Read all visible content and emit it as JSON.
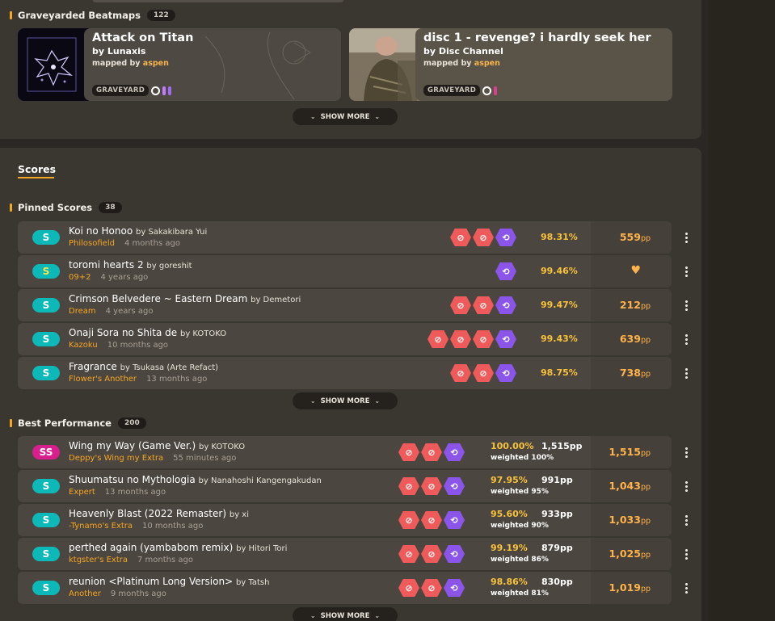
{
  "graveyarded": {
    "label": "Graveyarded Beatmaps",
    "count": "122",
    "show_more": "SHOW MORE",
    "cards": [
      {
        "title": "Attack on Titan",
        "artist": "by Lunaxis",
        "mapped_prefix": "mapped by",
        "mapper": "aspen",
        "status": "GRAVEYARD",
        "pips": [
          "#c37bff",
          "#a06cf0"
        ]
      },
      {
        "title": "disc 1 - revenge? i hardly seek her",
        "artist": "by Disc Channel",
        "mapped_prefix": "mapped by",
        "mapper": "aspen",
        "status": "GRAVEYARD",
        "pips": [
          "#d9418e"
        ]
      }
    ]
  },
  "scores_tab": "Scores",
  "pinned": {
    "label": "Pinned Scores",
    "count": "38",
    "show_more": "SHOW MORE",
    "rows": [
      {
        "rank": "S",
        "rank_class": "rank-s",
        "title": "Koi no Honoo",
        "artist": "by Sakakibara Yui",
        "diff": "Philosofield",
        "ago": "4 months ago",
        "mods": [
          "red",
          "red",
          "purple"
        ],
        "acc": "98.31%",
        "pp": "559",
        "pp_unit": "pp"
      },
      {
        "rank": "S",
        "rank_class": "rank-s2",
        "title": "toromi hearts 2",
        "artist": "by goreshit",
        "diff": "09+2",
        "ago": "4 years ago",
        "mods": [
          "purple"
        ],
        "acc": "99.46%",
        "pp": "",
        "pp_unit": "",
        "heart": true
      },
      {
        "rank": "S",
        "rank_class": "rank-s",
        "title": "Crimson Belvedere ~ Eastern Dream",
        "artist": "by Demetori",
        "diff": "Dream",
        "ago": "4 years ago",
        "mods": [
          "red",
          "red",
          "purple"
        ],
        "acc": "99.47%",
        "pp": "212",
        "pp_unit": "pp"
      },
      {
        "rank": "S",
        "rank_class": "rank-s",
        "title": "Onaji Sora no Shita de",
        "artist": "by KOTOKO",
        "diff": "Kazoku",
        "ago": "10 months ago",
        "mods": [
          "red",
          "red",
          "red",
          "purple"
        ],
        "acc": "99.43%",
        "pp": "639",
        "pp_unit": "pp"
      },
      {
        "rank": "S",
        "rank_class": "rank-s",
        "title": "Fragrance",
        "artist": "by Tsukasa (Arte Refact)",
        "diff": "Flower's Another",
        "ago": "13 months ago",
        "mods": [
          "red",
          "red",
          "purple"
        ],
        "acc": "98.75%",
        "pp": "738",
        "pp_unit": "pp"
      }
    ]
  },
  "best": {
    "label": "Best Performance",
    "count": "200",
    "show_more": "SHOW MORE",
    "rows": [
      {
        "rank": "SS",
        "rank_class": "rank-ss",
        "title": "Wing my Way (Game Ver.)",
        "artist": "by KOTOKO",
        "diff": "Deppy's Wing my Extra",
        "ago": "55 minutes ago",
        "mods": [
          "red",
          "red",
          "purple"
        ],
        "acc": "100.00%",
        "raw_pp": "1,515pp",
        "weighted": "weighted 100%",
        "pp": "1,515",
        "pp_unit": "pp"
      },
      {
        "rank": "S",
        "rank_class": "rank-s",
        "title": "Shuumatsu no Mythologia",
        "artist": "by Nanahoshi Kangengakudan",
        "diff": "Expert",
        "ago": "13 months ago",
        "mods": [
          "red",
          "red",
          "purple"
        ],
        "acc": "97.95%",
        "raw_pp": "991pp",
        "weighted": "weighted 95%",
        "pp": "1,043",
        "pp_unit": "pp"
      },
      {
        "rank": "S",
        "rank_class": "rank-s",
        "title": "Heavenly Blast (2022 Remaster)",
        "artist": "by xi",
        "diff": "-Tynamo's Extra",
        "ago": "10 months ago",
        "mods": [
          "red",
          "red",
          "purple"
        ],
        "acc": "95.60%",
        "raw_pp": "933pp",
        "weighted": "weighted 90%",
        "pp": "1,033",
        "pp_unit": "pp"
      },
      {
        "rank": "S",
        "rank_class": "rank-s",
        "title": "perthed again (yambabom remix)",
        "artist": "by Hitori Tori",
        "diff": "ktgster's Extra",
        "ago": "7 months ago",
        "mods": [
          "red",
          "red",
          "purple"
        ],
        "acc": "99.19%",
        "raw_pp": "879pp",
        "weighted": "weighted 86%",
        "pp": "1,025",
        "pp_unit": "pp"
      },
      {
        "rank": "S",
        "rank_class": "rank-s",
        "title": "reunion <Platinum Long Version>",
        "artist": "by Tatsh",
        "diff": "Another",
        "ago": "9 months ago",
        "mods": [
          "red",
          "red",
          "purple"
        ],
        "acc": "98.86%",
        "raw_pp": "830pp",
        "weighted": "weighted 81%",
        "pp": "1,019",
        "pp_unit": "pp"
      }
    ]
  }
}
